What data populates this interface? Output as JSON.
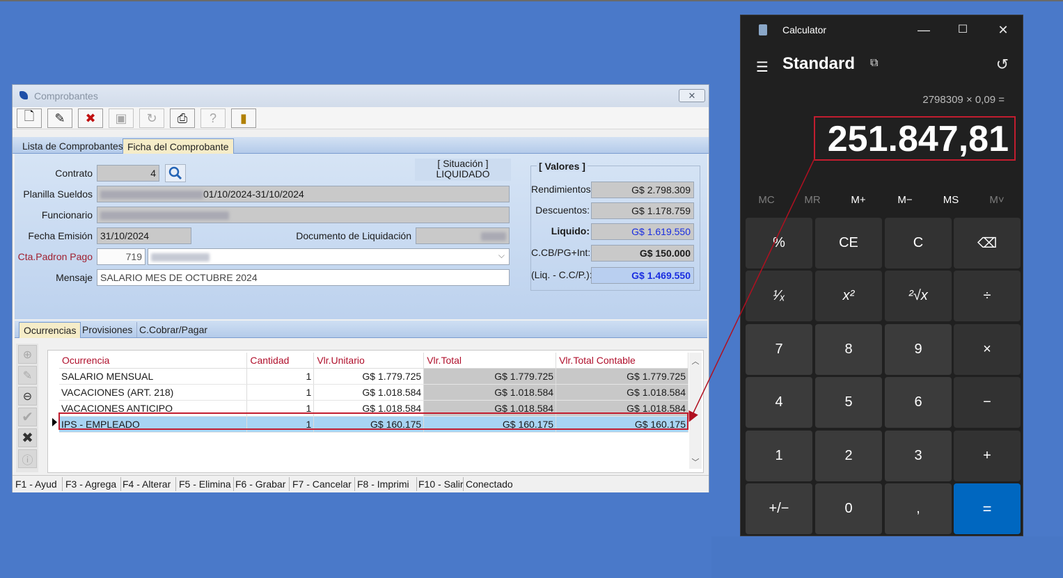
{
  "window": {
    "title": "Comprobantes",
    "close_label": "✕",
    "toolbar_icons": [
      "new-doc-icon",
      "edit-doc-icon",
      "delete-icon",
      "save-icon",
      "refresh-icon",
      "print-icon",
      "help-icon",
      "exit-icon"
    ],
    "tabs": [
      "Lista de Comprobantes",
      "Ficha del Comprobante"
    ],
    "active_tab": "Ficha del Comprobante"
  },
  "form": {
    "contrato_label": "Contrato",
    "contrato_value": "4",
    "situacion_label": "[ Situación ]",
    "situacion_value": "LIQUIDADO",
    "planilla_label": "Planilla Sueldos",
    "planilla_value": "01/10/2024-31/10/2024",
    "funcionario_label": "Funcionario",
    "fecha_label": "Fecha Emisión",
    "fecha_value": "31/10/2024",
    "doc_liq_label": "Documento de Liquidación",
    "cta_label": "Cta.Padron Pago",
    "cta_value": "719",
    "mensaje_label": "Mensaje",
    "mensaje_value": "SALARIO MES DE OCTUBRE 2024"
  },
  "valores": {
    "header": "[ Valores ]",
    "rendimientos_label": "Rendimientos:",
    "rendimientos_value": "G$ 2.798.309",
    "descuentos_label": "Descuentos:",
    "descuentos_value": "G$ 1.178.759",
    "liquido_label": "Liquido:",
    "liquido_value": "G$ 1.619.550",
    "ccb_label": "C.CB/PG+Int:",
    "ccb_value": "G$ 150.000",
    "liq_cc_label": "(Liq. - C.C/P.):",
    "liq_cc_value": "G$ 1.469.550"
  },
  "subtabs": [
    "Ocurrencias",
    "Provisiones",
    "C.Cobrar/Pagar"
  ],
  "table": {
    "headers": [
      "Ocurrencia",
      "Cantidad",
      "Vlr.Unitario",
      "Vlr.Total",
      "Vlr.Total Contable"
    ],
    "rows": [
      [
        "SALARIO MENSUAL",
        "1",
        "G$ 1.779.725",
        "G$ 1.779.725",
        "G$ 1.779.725"
      ],
      [
        "VACACIONES (ART. 218)",
        "1",
        "G$ 1.018.584",
        "G$ 1.018.584",
        "G$ 1.018.584"
      ],
      [
        "VACACIONES ANTICIPO",
        "1",
        "G$ 1.018.584",
        "G$ 1.018.584",
        "G$ 1.018.584"
      ],
      [
        "IPS - EMPLEADO",
        "1",
        "G$ 160.175",
        "G$ 160.175",
        "G$ 160.175"
      ]
    ],
    "selected_row": 3
  },
  "statusbar": [
    "F1 - Ayud",
    "F3 - Agrega",
    "F4 - Alterar",
    "F5 - Elimina",
    "F6 - Grabar",
    "F7 - Cancelar",
    "F8 - Imprimi",
    "F10 - Salir",
    "Conectado"
  ],
  "calculator": {
    "title": "Calculator",
    "mode": "Standard",
    "expression": "2798309 × 0,09 =",
    "display": "251.847,81",
    "memory": [
      "MC",
      "MR",
      "M+",
      "M−",
      "MS",
      "M˅"
    ],
    "keys": [
      [
        "%",
        "CE",
        "C",
        "⌫"
      ],
      [
        "¹⁄ₓ",
        "x²",
        "²√x",
        "÷"
      ],
      [
        "7",
        "8",
        "9",
        "×"
      ],
      [
        "4",
        "5",
        "6",
        "−"
      ],
      [
        "1",
        "2",
        "3",
        "+"
      ],
      [
        "+/−",
        "0",
        ",",
        "="
      ]
    ]
  },
  "colors": {
    "desktop": "#4a79c9",
    "highlight": "#c21d2f",
    "equals": "#0067c0"
  }
}
